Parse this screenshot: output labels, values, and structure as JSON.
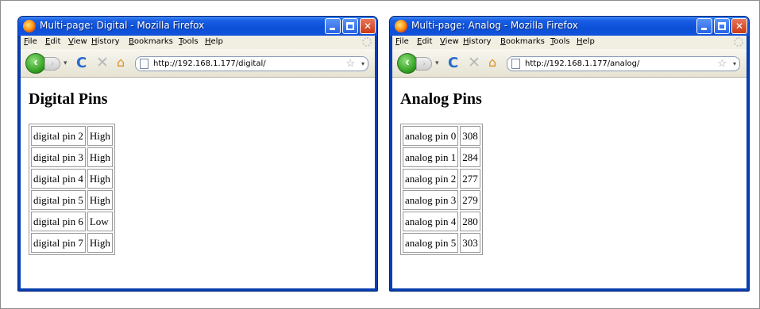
{
  "windows": [
    {
      "title": "Multi-page: Digital - Mozilla Firefox",
      "menu": [
        "File",
        "Edit",
        "View",
        "History",
        "Bookmarks",
        "Tools",
        "Help"
      ],
      "url": "http://192.168.1.177/digital/",
      "heading": "Digital Pins",
      "rows": [
        {
          "pin": "digital pin 2",
          "value": "High"
        },
        {
          "pin": "digital pin 3",
          "value": "High"
        },
        {
          "pin": "digital pin 4",
          "value": "High"
        },
        {
          "pin": "digital pin 5",
          "value": "High"
        },
        {
          "pin": "digital pin 6",
          "value": "Low"
        },
        {
          "pin": "digital pin 7",
          "value": "High"
        }
      ]
    },
    {
      "title": "Multi-page: Analog - Mozilla Firefox",
      "menu": [
        "File",
        "Edit",
        "View",
        "History",
        "Bookmarks",
        "Tools",
        "Help"
      ],
      "url": "http://192.168.1.177/analog/",
      "heading": "Analog Pins",
      "rows": [
        {
          "pin": "analog pin 0",
          "value": "308"
        },
        {
          "pin": "analog pin 1",
          "value": "284"
        },
        {
          "pin": "analog pin 2",
          "value": "277"
        },
        {
          "pin": "analog pin 3",
          "value": "279"
        },
        {
          "pin": "analog pin 4",
          "value": "280"
        },
        {
          "pin": "analog pin 5",
          "value": "303"
        }
      ]
    }
  ],
  "icons": {
    "app": "firefox-logo-icon",
    "minimize": "minimize-icon",
    "maximize": "maximize-icon",
    "close": "close-icon",
    "back": "back-arrow-icon",
    "forward": "forward-arrow-icon",
    "reload": "reload-icon",
    "stop": "stop-icon",
    "home": "home-icon",
    "page": "page-icon",
    "bookmark": "star-icon",
    "throbber": "throbber-icon"
  }
}
